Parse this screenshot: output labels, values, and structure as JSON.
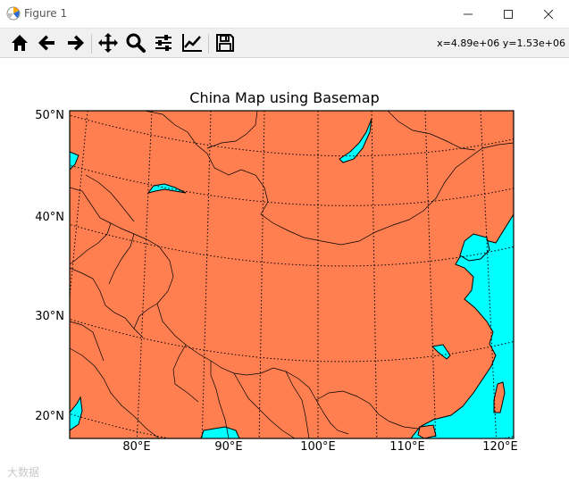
{
  "window": {
    "title": "Figure 1"
  },
  "toolbar": {
    "buttons": [
      "home-icon",
      "back-icon",
      "forward-icon",
      "pan-icon",
      "zoom-icon",
      "configure-icon",
      "edit-axis-icon",
      "save-icon"
    ],
    "coords_text": "x=4.89e+06 y=1.53e+06"
  },
  "plot": {
    "title": "China Map using Basemap",
    "y_ticks": [
      "50°N",
      "40°N",
      "30°N",
      "20°N"
    ],
    "x_ticks": [
      "80°E",
      "90°E",
      "100°E",
      "110°E",
      "120°E"
    ]
  },
  "colors": {
    "land": "#ff7f50",
    "water": "#00ffff",
    "border": "#000000"
  },
  "watermark": "大数据"
}
